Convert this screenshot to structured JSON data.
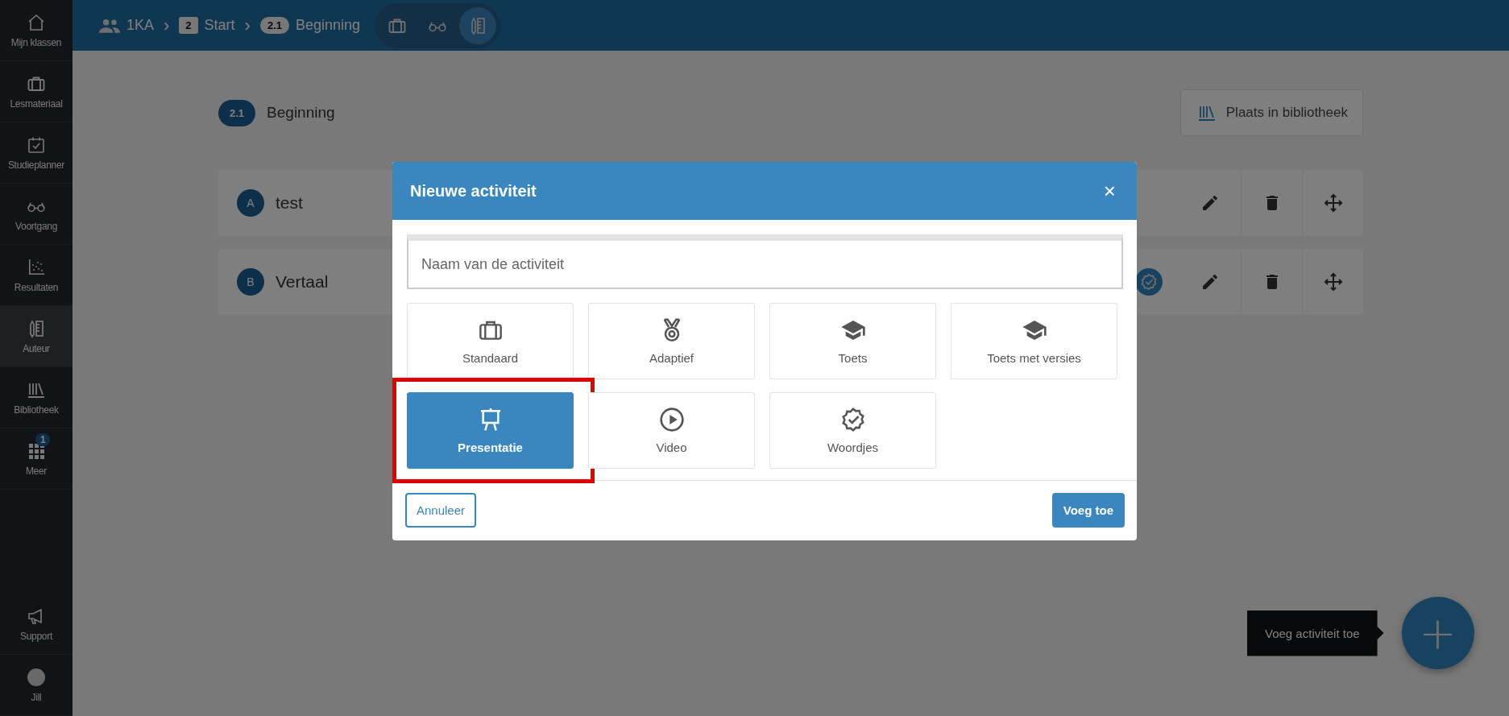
{
  "sidebar": {
    "items": [
      {
        "label": "Mijn klassen",
        "selected": false
      },
      {
        "label": "Lesmateriaal",
        "selected": false
      },
      {
        "label": "Studieplanner",
        "selected": false
      },
      {
        "label": "Voortgang",
        "selected": false
      },
      {
        "label": "Resultaten",
        "selected": false
      },
      {
        "label": "Auteur",
        "selected": true
      },
      {
        "label": "Bibliotheek",
        "selected": false
      },
      {
        "label": "Meer",
        "selected": false,
        "badge": "1"
      }
    ],
    "bottom": [
      {
        "label": "Support"
      },
      {
        "label": "Jill"
      }
    ]
  },
  "breadcrumb": [
    {
      "kind": "group",
      "label": "1KA"
    },
    {
      "kind": "square",
      "separator": "›",
      "number": "2",
      "label": "Start"
    },
    {
      "kind": "pill",
      "separator": "›",
      "number": "2.1",
      "label": "Beginning"
    }
  ],
  "view_switch": [
    {
      "selected": false
    },
    {
      "selected": false
    },
    {
      "selected": true
    }
  ],
  "page": {
    "number": "2.1",
    "title": "Beginning",
    "library_button": "Plaats in bibliotheek"
  },
  "activities": [
    {
      "letter": "A",
      "name": "test",
      "verified": false
    },
    {
      "letter": "B",
      "name": "Vertaal",
      "verified": true
    }
  ],
  "modal": {
    "title": "Nieuwe activiteit",
    "close": "×",
    "name_field": {
      "placeholder": "Naam van de activiteit"
    },
    "types": [
      {
        "label": "Standaard",
        "selected": false,
        "highlighted": false
      },
      {
        "label": "Adaptief",
        "selected": false,
        "highlighted": false
      },
      {
        "label": "Toets",
        "selected": false,
        "highlighted": false
      },
      {
        "label": "Toets met versies",
        "selected": false,
        "highlighted": false
      },
      {
        "label": "Presentatie",
        "selected": true,
        "highlighted": true
      },
      {
        "label": "Video",
        "selected": false,
        "highlighted": false
      },
      {
        "label": "Woordjes",
        "selected": false,
        "highlighted": false
      }
    ],
    "cancel": "Annuleer",
    "submit": "Voeg toe"
  },
  "fab": {
    "tooltip": "Voeg activiteit toe",
    "symbol": "+"
  }
}
